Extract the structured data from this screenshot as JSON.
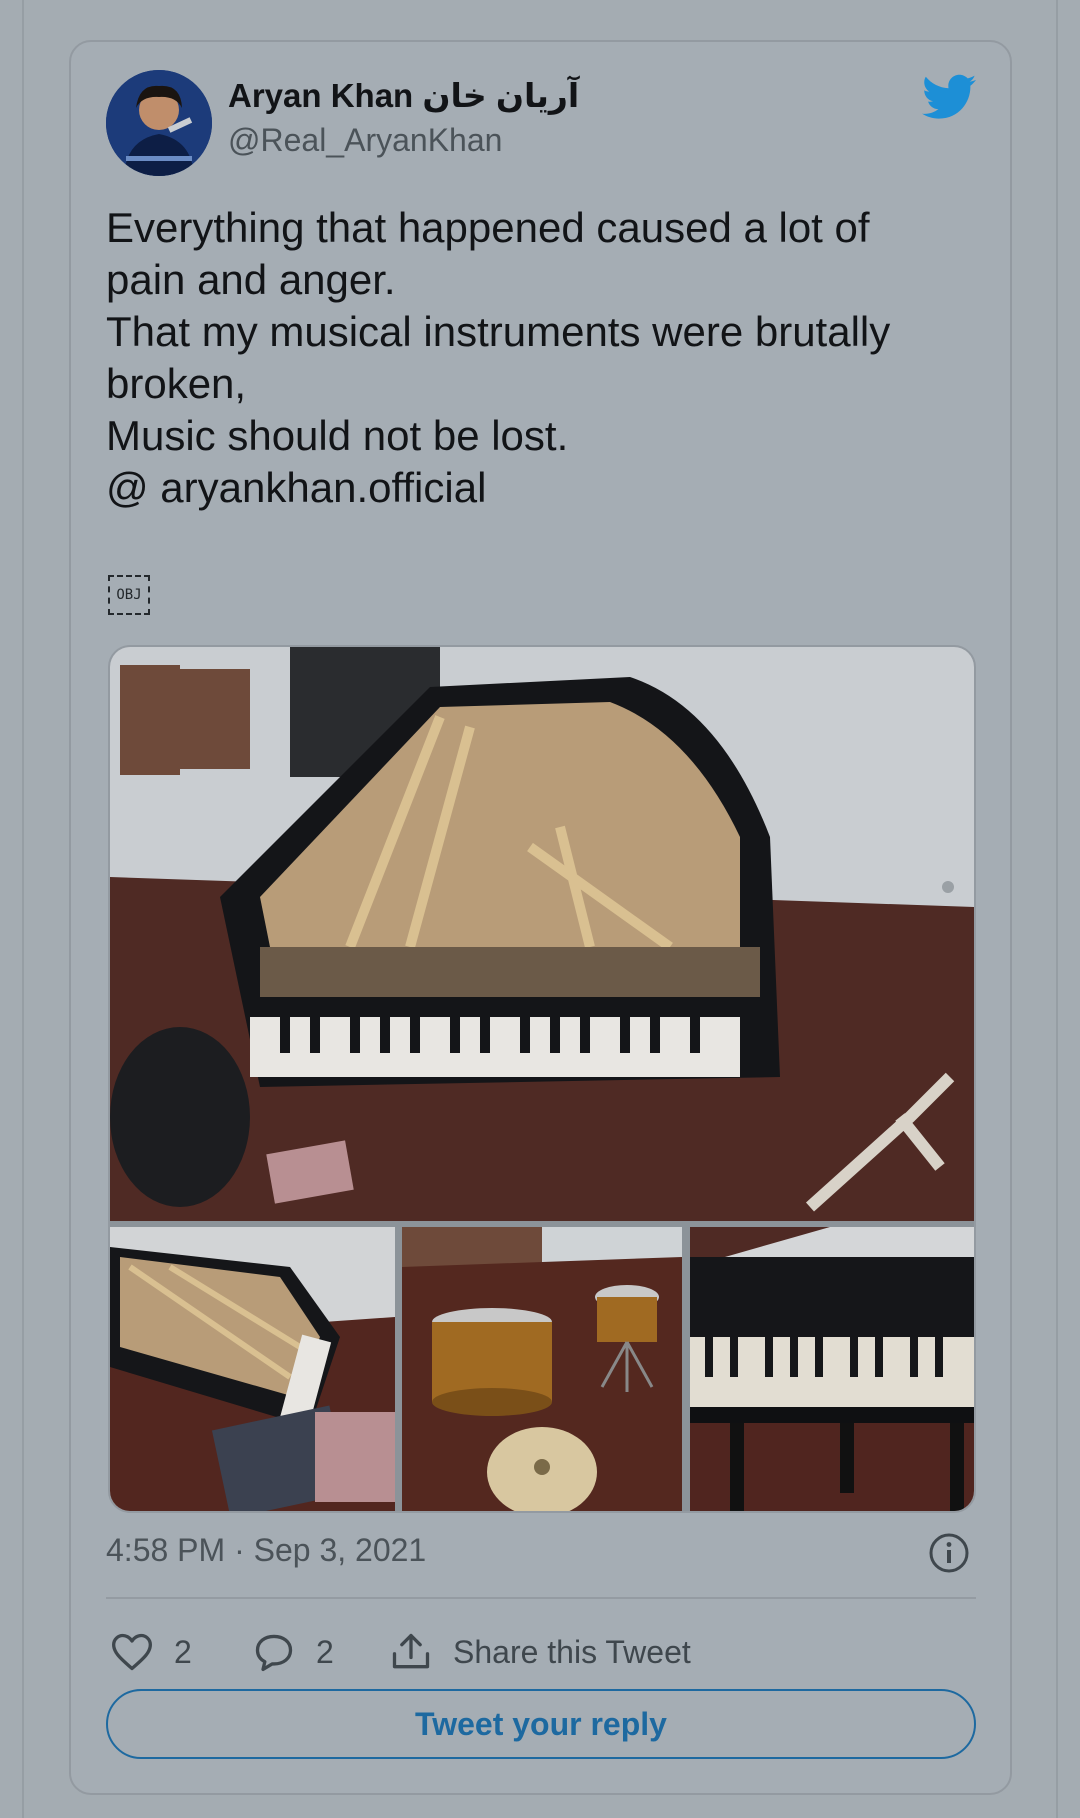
{
  "tweet": {
    "author_name": "Aryan Khan آریان خان",
    "handle": "@Real_AryanKhan",
    "text_lines": [
      "Everything that happened caused a lot of",
      "pain and anger.",
      "That my musical instruments were brutally",
      "broken,",
      "Music should not be lost.",
      "@ aryankhan.official"
    ],
    "object_placeholder": "OBJ",
    "timestamp": "4:58 PM · Sep 3, 2021"
  },
  "actions": {
    "like_count": "2",
    "reply_count": "2",
    "share_label": "Share this Tweet"
  },
  "reply_button_label": "Tweet your reply",
  "icons": {
    "brand": "twitter-bird-icon",
    "info": "info-icon",
    "like": "heart-icon",
    "reply": "speech-bubble-icon",
    "share": "share-upload-icon"
  },
  "colors": {
    "twitter_blue": "#1d8fd6",
    "reply_button": "#1d69a0",
    "page_overlay": "#a4acb2"
  }
}
